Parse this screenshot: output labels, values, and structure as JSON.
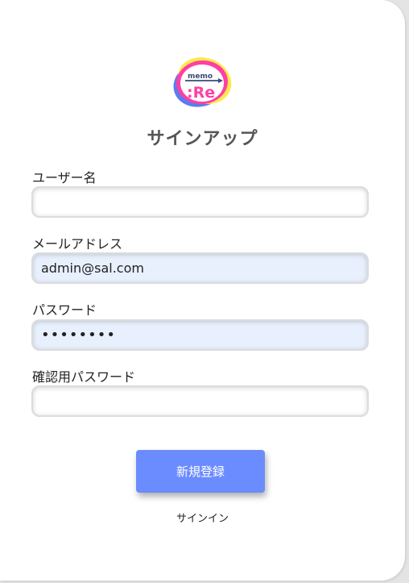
{
  "logo": {
    "small_text": "memo",
    "main_text": ":Re"
  },
  "form": {
    "title": "サインアップ",
    "username": {
      "label": "ユーザー名",
      "value": ""
    },
    "email": {
      "label": "メールアドレス",
      "value": "admin@sal.com"
    },
    "password": {
      "label": "パスワード",
      "value": "••••••••"
    },
    "confirm_password": {
      "label": "確認用パスワード",
      "value": ""
    },
    "submit_label": "新規登録",
    "signin_link": "サインイン"
  },
  "colors": {
    "accent": "#6b8cff",
    "autofill_bg": "#e8f0fe",
    "logo_pink": "#ff3fa4",
    "logo_yellow": "#ffe94a",
    "logo_blue": "#5b7cf0"
  }
}
